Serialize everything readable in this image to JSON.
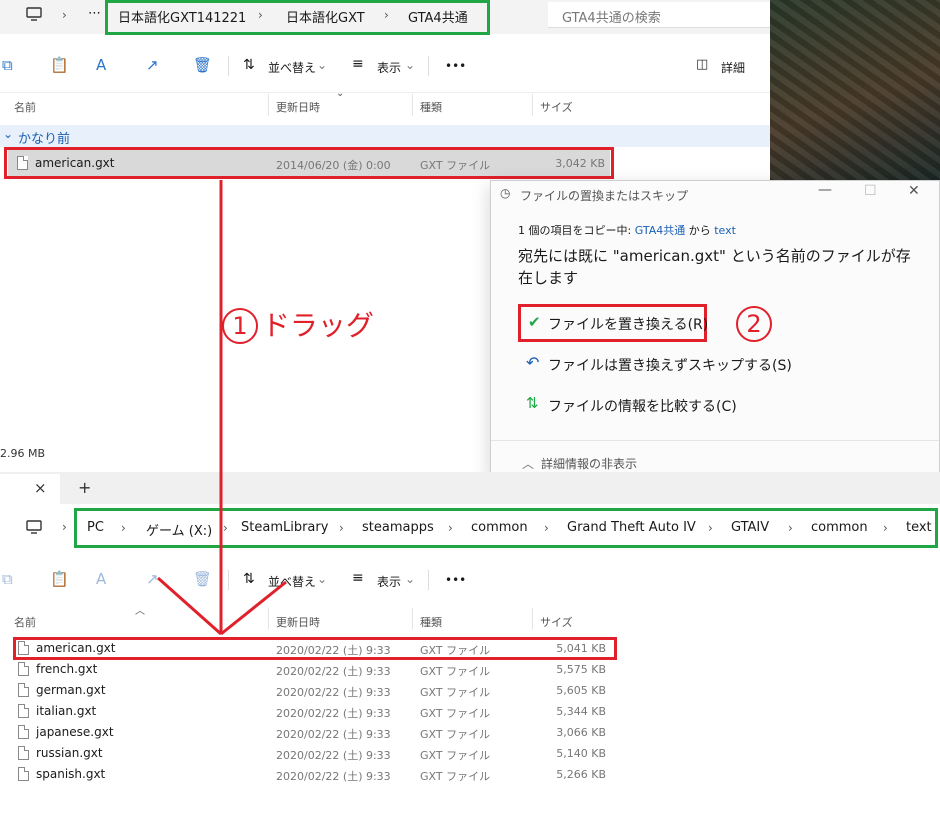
{
  "top_window": {
    "breadcrumb": [
      "日本語化GXT141221",
      "日本語化GXT",
      "GTA4共通"
    ],
    "search_placeholder": "GTA4共通の検索",
    "toolbar": {
      "sort_label": "並べ替え",
      "view_label": "表示",
      "details_label": "詳細",
      "more": "•••"
    },
    "columns": [
      "名前",
      "更新日時",
      "種類",
      "サイズ"
    ],
    "group_label": "かなり前",
    "file": {
      "name": "american.gxt",
      "date": "2014/06/20 (金) 0:00",
      "type": "GXT ファイル",
      "size": "3,042 KB"
    },
    "status_size": "2.96 MB"
  },
  "dialog": {
    "title": "ファイルの置換またはスキップ",
    "copy_line_prefix": "1 個の項目をコピー中:",
    "copy_src": "GTA4共通",
    "copy_from": "から",
    "copy_dst": "text",
    "message": "宛先には既に \"american.gxt\" という名前のファイルが存在します",
    "option_replace": "ファイルを置き換える(R)",
    "option_skip": "ファイルは置き換えずスキップする(S)",
    "option_compare": "ファイルの情報を比較する(C)",
    "footer": "詳細情報の非表示"
  },
  "tabbar": {
    "close": "×",
    "add": "+"
  },
  "bottom_window": {
    "breadcrumb": [
      "PC",
      "ゲーム (X:)",
      "SteamLibrary",
      "steamapps",
      "common",
      "Grand Theft Auto IV",
      "GTAIV",
      "common",
      "text"
    ],
    "toolbar": {
      "sort_label": "並べ替え",
      "view_label": "表示",
      "more": "•••"
    },
    "columns": [
      "名前",
      "更新日時",
      "種類",
      "サイズ"
    ],
    "files": [
      {
        "name": "american.gxt",
        "date": "2020/02/22 (土) 9:33",
        "type": "GXT ファイル",
        "size": "5,041 KB"
      },
      {
        "name": "french.gxt",
        "date": "2020/02/22 (土) 9:33",
        "type": "GXT ファイル",
        "size": "5,575 KB"
      },
      {
        "name": "german.gxt",
        "date": "2020/02/22 (土) 9:33",
        "type": "GXT ファイル",
        "size": "5,605 KB"
      },
      {
        "name": "italian.gxt",
        "date": "2020/02/22 (土) 9:33",
        "type": "GXT ファイル",
        "size": "5,344 KB"
      },
      {
        "name": "japanese.gxt",
        "date": "2020/02/22 (土) 9:33",
        "type": "GXT ファイル",
        "size": "3,066 KB"
      },
      {
        "name": "russian.gxt",
        "date": "2020/02/22 (土) 9:33",
        "type": "GXT ファイル",
        "size": "5,140 KB"
      },
      {
        "name": "spanish.gxt",
        "date": "2020/02/22 (土) 9:33",
        "type": "GXT ファイル",
        "size": "5,266 KB"
      }
    ]
  },
  "annotations": {
    "step1_number": "1",
    "step1_text": "ドラッグ",
    "step2_number": "2"
  },
  "colors": {
    "annotation_red": "#e0202a",
    "annotation_green": "#21a646",
    "accent_blue": "#1a5fb4"
  }
}
